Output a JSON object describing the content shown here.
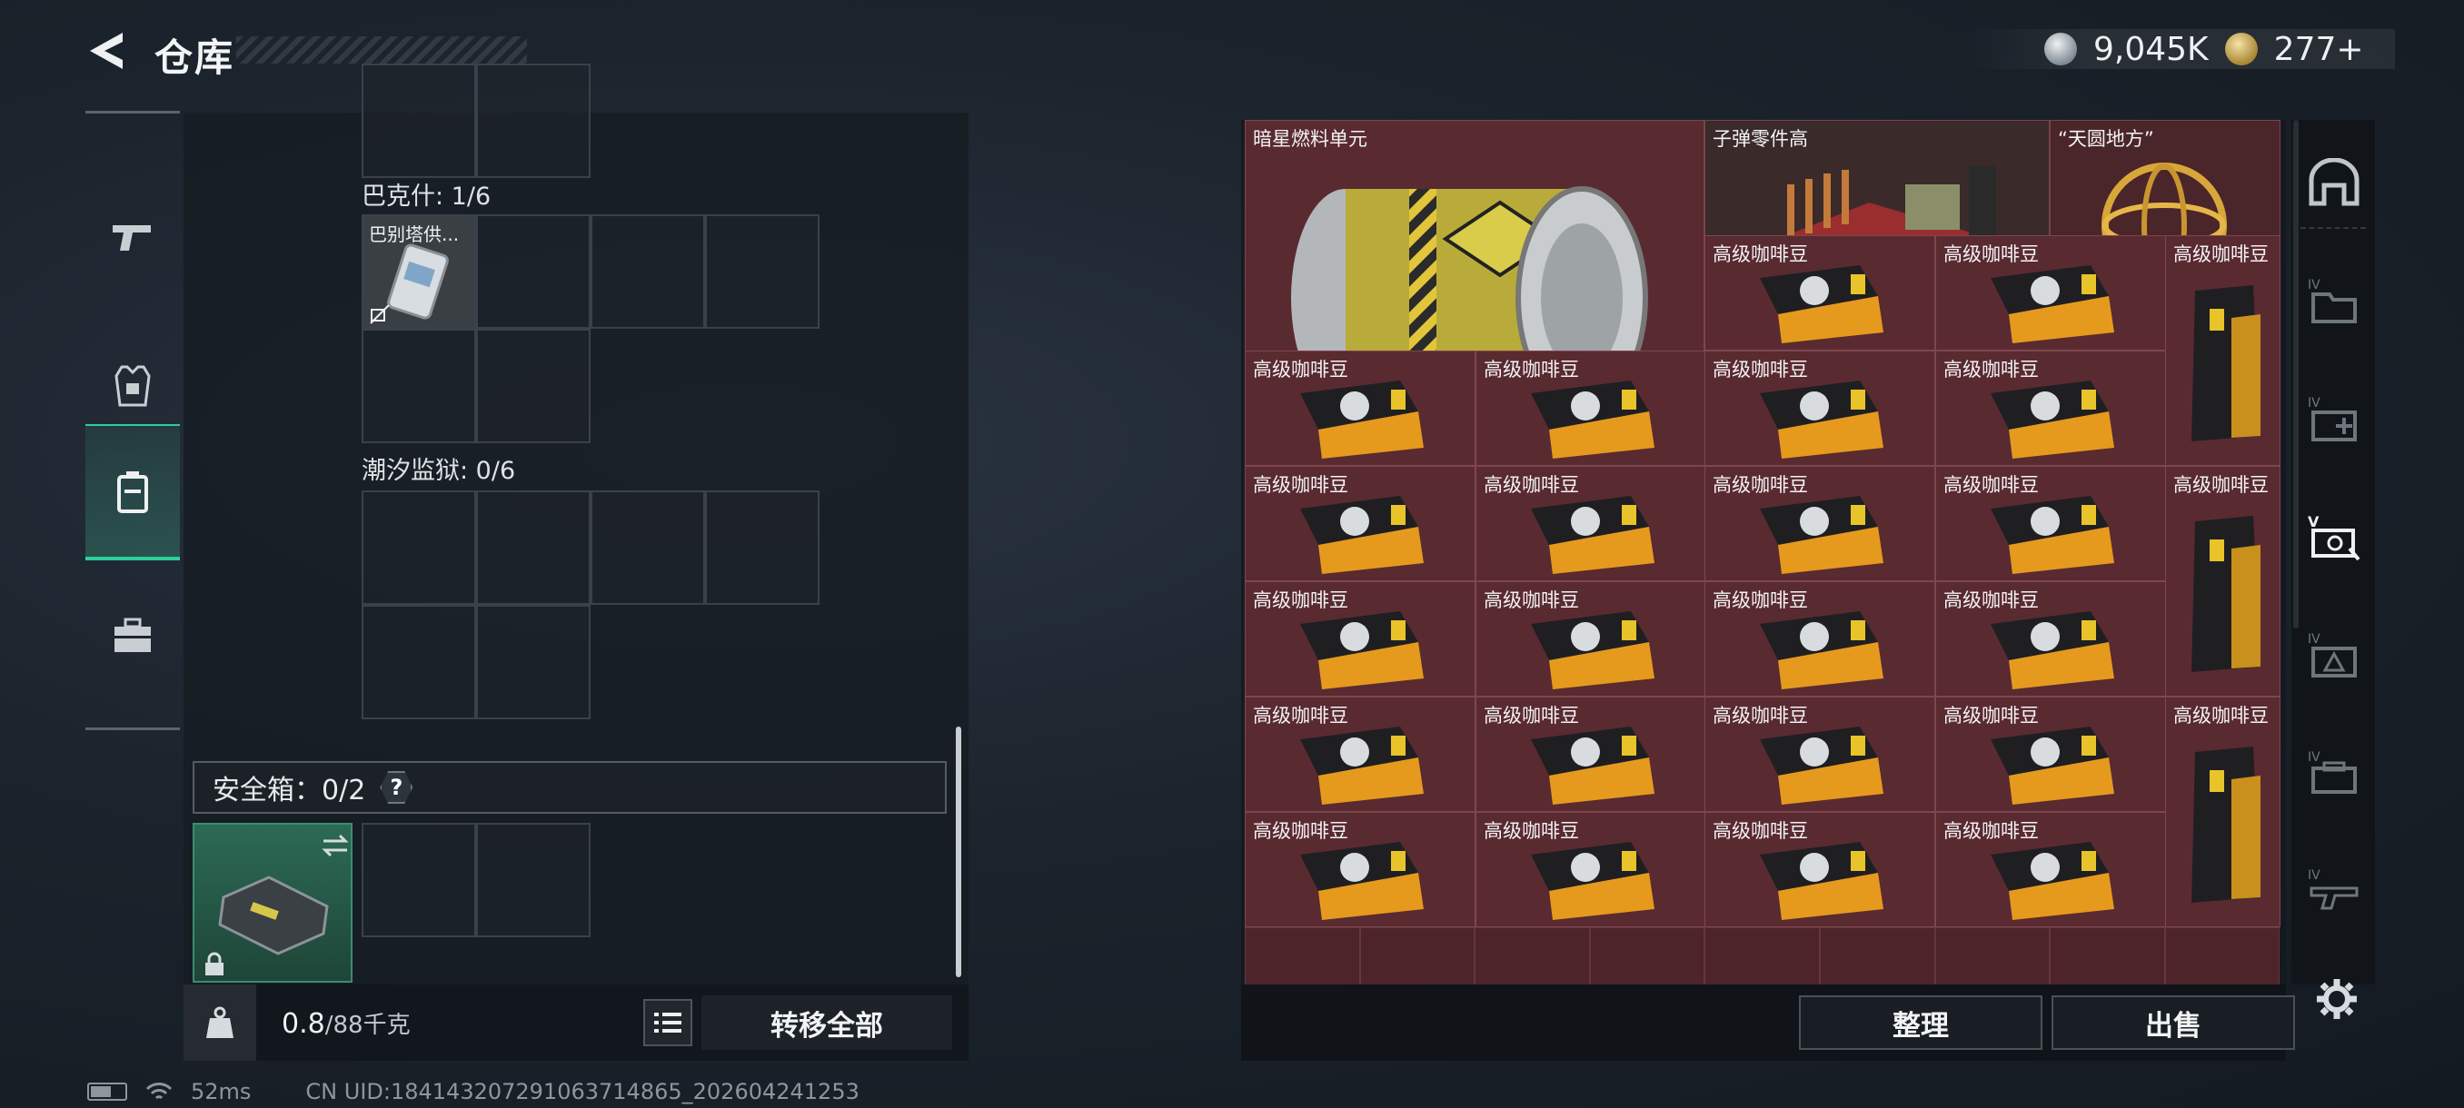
{
  "header": {
    "title": "仓库",
    "currencies": [
      {
        "icon": "silver-coin-icon",
        "value": "9,045K"
      },
      {
        "icon": "gold-coin-icon",
        "value": "277+"
      }
    ]
  },
  "left_tabs": [
    {
      "icon": "gun-icon",
      "active": false
    },
    {
      "icon": "armor-vest-icon",
      "active": false
    },
    {
      "icon": "backpack-icon",
      "active": true
    },
    {
      "icon": "toolbox-icon",
      "active": false
    }
  ],
  "container": {
    "sections": [
      {
        "label": "巴克什: 1/6",
        "item_label": "巴别塔供..."
      },
      {
        "label": "潮汐监狱: 0/6"
      }
    ],
    "safe_box": {
      "label": "安全箱：0/2",
      "help": "?"
    }
  },
  "bottom_left": {
    "weight_current": "0.8",
    "weight_max": "/88千克",
    "transfer_all": "转移全部"
  },
  "stash": {
    "big_items": [
      {
        "name": "暗星燃料单元"
      },
      {
        "name": "子弹零件高"
      },
      {
        "name": "“天圆地方”"
      }
    ],
    "coffee_label": "高级咖啡豆"
  },
  "bottom_right": {
    "sort": "整理",
    "sell": "出售"
  },
  "footer": {
    "ping": "52ms",
    "uid": "CN UID:18414320729106371486​5_202604241253"
  },
  "colors": {
    "accent": "#2ccf9a",
    "stash_cell": "#4e242b"
  }
}
